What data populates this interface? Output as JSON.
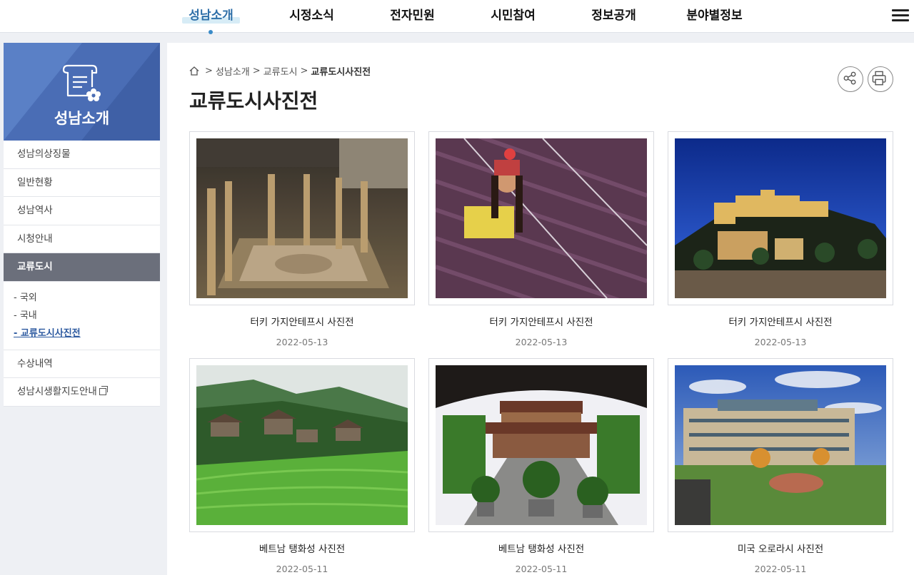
{
  "nav": {
    "items": [
      "성남소개",
      "시정소식",
      "전자민원",
      "시민참여",
      "정보공개",
      "분야별정보"
    ],
    "active_index": 0
  },
  "sidebar": {
    "title": "성남소개",
    "items_top": [
      "성남의상징물",
      "일반현황",
      "성남역사",
      "시청안내"
    ],
    "active_item": "교류도시",
    "sub_items": [
      "- 국외",
      "- 국내",
      "- 교류도시사진전"
    ],
    "items_bottom": [
      "수상내역",
      "성남시생활지도안내"
    ]
  },
  "breadcrumb": [
    "성남소개",
    "교류도시",
    "교류도시사진전"
  ],
  "page_title": "교류도시사진전",
  "gallery": [
    {
      "caption": "터키 가지안테프시 사진전",
      "date": "2022-05-13"
    },
    {
      "caption": "터키 가지안테프시 사진전",
      "date": "2022-05-13"
    },
    {
      "caption": "터키 가지안테프시 사진전",
      "date": "2022-05-13"
    },
    {
      "caption": "베트남 탱화성 사진전",
      "date": "2022-05-11"
    },
    {
      "caption": "베트남 탱화성 사진전",
      "date": "2022-05-11"
    },
    {
      "caption": "미국 오로라시 사진전",
      "date": "2022-05-11"
    }
  ],
  "colors": {
    "accent": "#2e6fa8",
    "sidebar_header": "#4a6db5",
    "sidebar_active": "#6b6f7b"
  }
}
